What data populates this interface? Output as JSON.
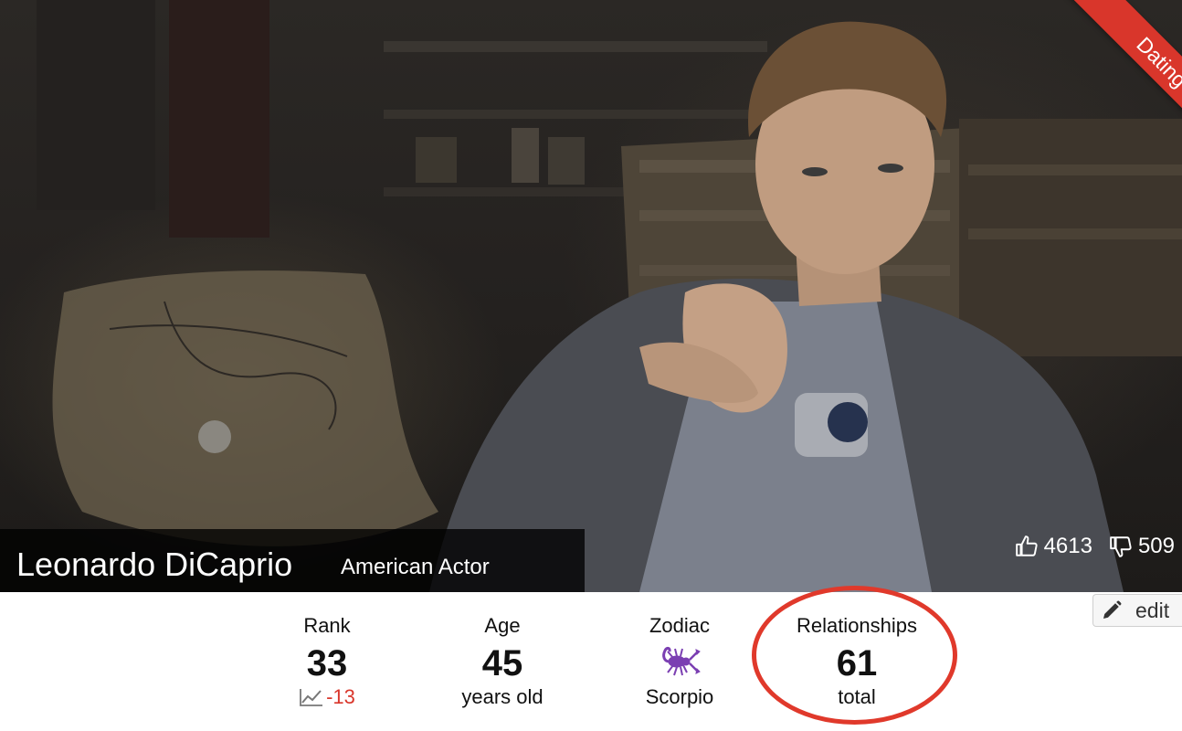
{
  "profile": {
    "name": "Leonardo DiCaprio",
    "role": "American Actor",
    "status_ribbon": "Dating"
  },
  "votes": {
    "up": "4613",
    "down": "509"
  },
  "edit": {
    "label": "edit"
  },
  "stats": {
    "rank": {
      "label": "Rank",
      "value": "33",
      "delta": "-13"
    },
    "age": {
      "label": "Age",
      "value": "45",
      "unit": "years old"
    },
    "zodiac": {
      "label": "Zodiac",
      "sign": "Scorpio",
      "icon": "scorpion-icon"
    },
    "relationships": {
      "label": "Relationships",
      "value": "61",
      "unit": "total"
    }
  },
  "colors": {
    "ribbon": "#d9362b",
    "rank_delta": "#d9362b",
    "zodiac_icon": "#7b3fb2",
    "highlight_ring": "#e0392b"
  }
}
